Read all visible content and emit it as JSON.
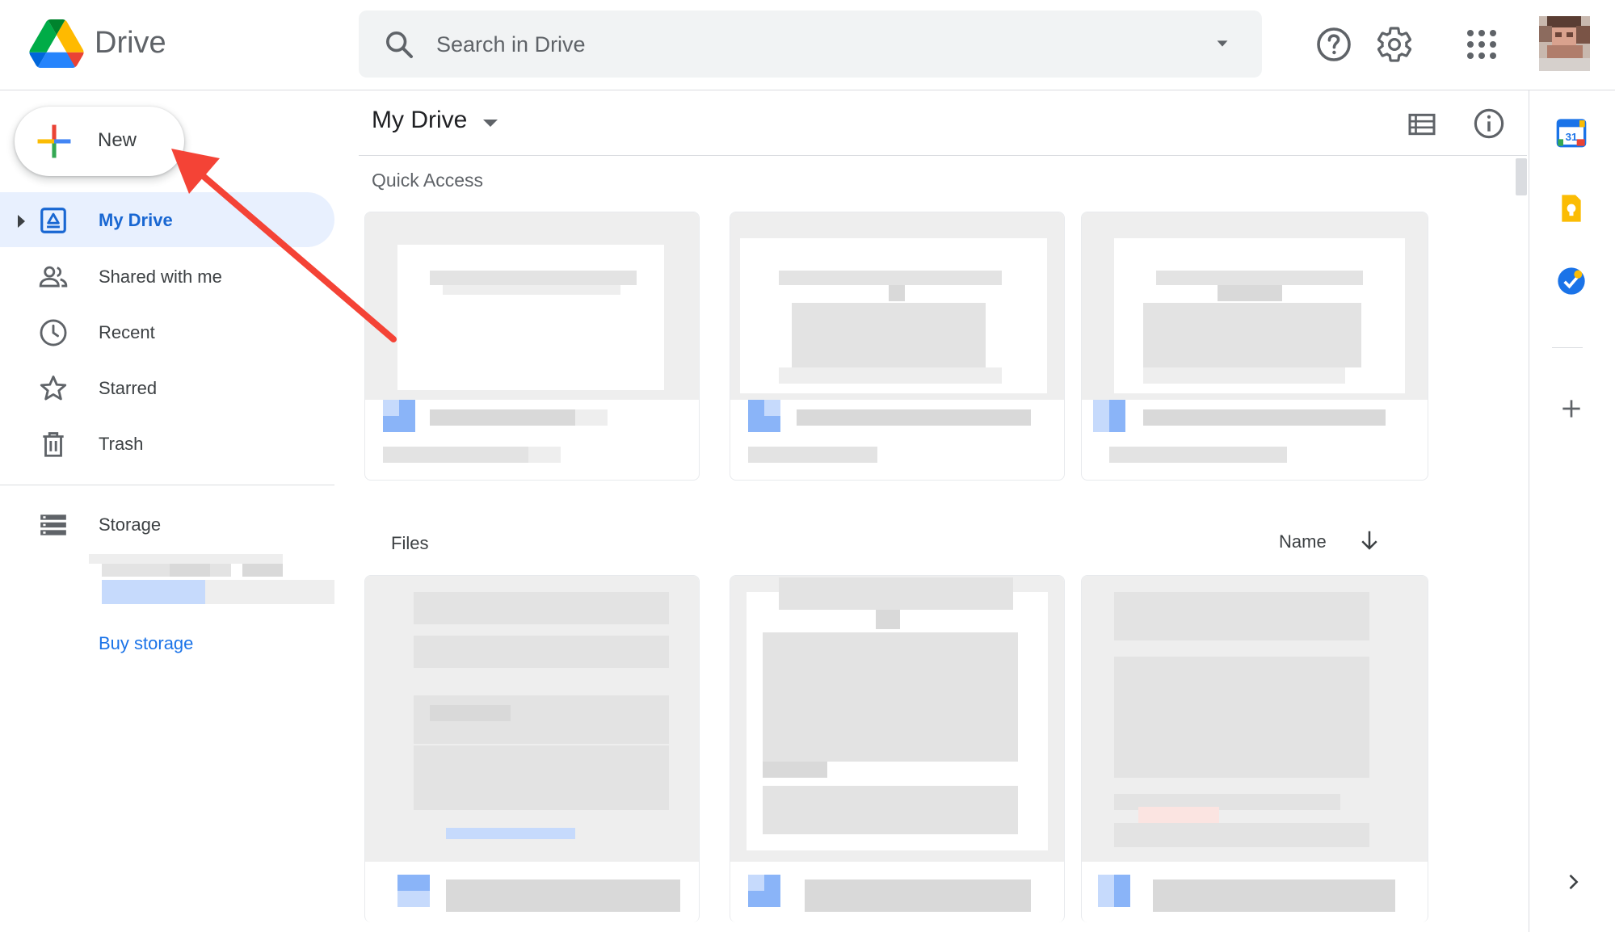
{
  "app": {
    "name": "Drive"
  },
  "search": {
    "placeholder": "Search in Drive"
  },
  "sidebar": {
    "new_label": "New",
    "items": [
      {
        "label": "My Drive",
        "icon": "my-drive-icon",
        "active": true
      },
      {
        "label": "Shared with me",
        "icon": "people-icon",
        "active": false
      },
      {
        "label": "Recent",
        "icon": "clock-icon",
        "active": false
      },
      {
        "label": "Starred",
        "icon": "star-icon",
        "active": false
      },
      {
        "label": "Trash",
        "icon": "trash-icon",
        "active": false
      }
    ],
    "storage_label": "Storage",
    "buy_storage_label": "Buy storage"
  },
  "main": {
    "title": "My Drive",
    "quick_access_label": "Quick Access",
    "files_label": "Files",
    "sort_label": "Name"
  },
  "colors": {
    "accent": "#1a73e8",
    "active_bg": "#e8f0fe",
    "annotation_arrow": "#f44336"
  }
}
